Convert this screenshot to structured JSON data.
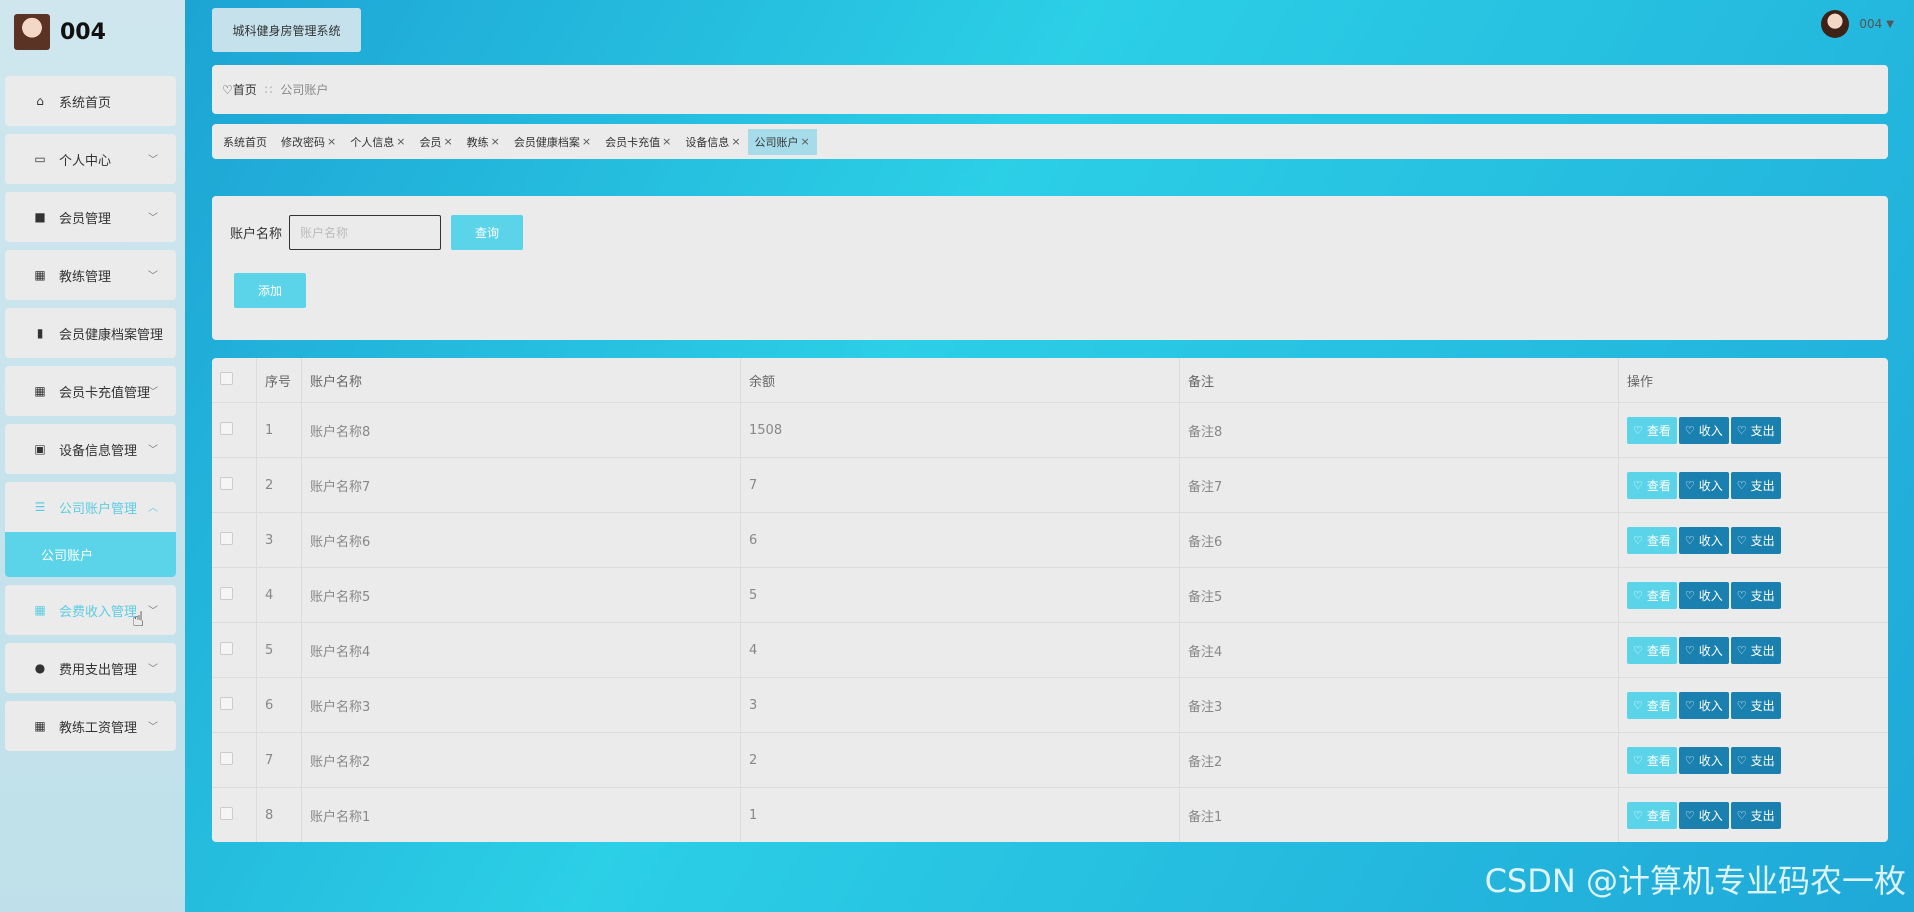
{
  "brand": {
    "title": "004"
  },
  "sidebar": {
    "items": [
      {
        "label": "系统首页",
        "icon": "home-icon",
        "glyph": "⌂",
        "has_children": false
      },
      {
        "label": "个人中心",
        "icon": "calendar-icon",
        "glyph": "▭",
        "has_children": true
      },
      {
        "label": "会员管理",
        "icon": "ticket-icon",
        "glyph": "■",
        "has_children": true
      },
      {
        "label": "教练管理",
        "icon": "grid-icon",
        "glyph": "▦",
        "has_children": true
      },
      {
        "label": "会员健康档案管理",
        "icon": "bar-chart-icon",
        "glyph": "▮",
        "has_children": false
      },
      {
        "label": "会员卡充值管理",
        "icon": "grid-icon",
        "glyph": "▦",
        "has_children": true
      },
      {
        "label": "设备信息管理",
        "icon": "clipboard-icon",
        "glyph": "▣",
        "has_children": true
      },
      {
        "label": "公司账户管理",
        "icon": "list-icon",
        "glyph": "☰",
        "has_children": true,
        "expanded": true
      },
      {
        "label": "会费收入管理",
        "icon": "grid-icon",
        "glyph": "▦",
        "has_children": true
      },
      {
        "label": "费用支出管理",
        "icon": "bulb-icon",
        "glyph": "●",
        "has_children": true
      },
      {
        "label": "教练工资管理",
        "icon": "grid-icon",
        "glyph": "▦",
        "has_children": true
      }
    ],
    "sub_item": "公司账户"
  },
  "header": {
    "system_title": "城科健身房管理系统",
    "user_name": "004"
  },
  "breadcrumb": {
    "home": "首页",
    "separator": "∷",
    "current": "公司账户"
  },
  "tabs": [
    {
      "label": "系统首页",
      "closable": false
    },
    {
      "label": "修改密码",
      "closable": true
    },
    {
      "label": "个人信息",
      "closable": true
    },
    {
      "label": "会员",
      "closable": true
    },
    {
      "label": "教练",
      "closable": true
    },
    {
      "label": "会员健康档案",
      "closable": true
    },
    {
      "label": "会员卡充值",
      "closable": true
    },
    {
      "label": "设备信息",
      "closable": true
    },
    {
      "label": "公司账户",
      "closable": true,
      "active": true
    }
  ],
  "search": {
    "label": "账户名称",
    "placeholder": "账户名称",
    "query_label": "查询",
    "add_label": "添加"
  },
  "table": {
    "headers": [
      "序号",
      "账户名称",
      "余额",
      "备注",
      "操作"
    ],
    "rows": [
      {
        "idx": "1",
        "name": "账户名称8",
        "balance": "1508",
        "note": "备注8"
      },
      {
        "idx": "2",
        "name": "账户名称7",
        "balance": "7",
        "note": "备注7"
      },
      {
        "idx": "3",
        "name": "账户名称6",
        "balance": "6",
        "note": "备注6"
      },
      {
        "idx": "4",
        "name": "账户名称5",
        "balance": "5",
        "note": "备注5"
      },
      {
        "idx": "5",
        "name": "账户名称4",
        "balance": "4",
        "note": "备注4"
      },
      {
        "idx": "6",
        "name": "账户名称3",
        "balance": "3",
        "note": "备注3"
      },
      {
        "idx": "7",
        "name": "账户名称2",
        "balance": "2",
        "note": "备注2"
      },
      {
        "idx": "8",
        "name": "账户名称1",
        "balance": "1",
        "note": "备注1"
      }
    ],
    "actions": {
      "view": "查看",
      "income": "收入",
      "expense": "支出"
    }
  },
  "watermark": "CSDN @计算机专业码农一枚",
  "colors": {
    "accent": "#5bd4e9",
    "action_dark": "#1a80b0",
    "panel": "#ebebeb"
  }
}
